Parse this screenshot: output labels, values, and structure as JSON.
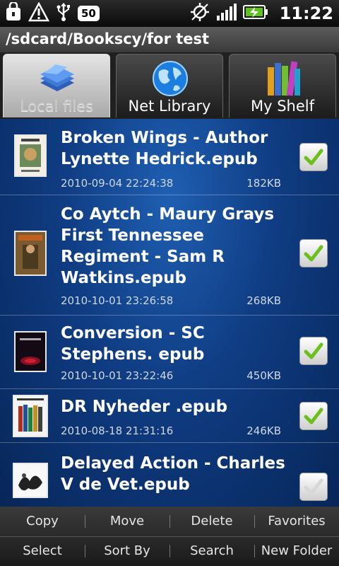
{
  "status_bar": {
    "icons_left": [
      "lock-bag-icon",
      "warning-icon",
      "usb-icon"
    ],
    "battery_text": "50",
    "icons_right": [
      "gps-icon",
      "signal-icon",
      "battery-charging-icon"
    ],
    "time": "11:22"
  },
  "path": "/sdcard/Bookscy/for test",
  "tabs": [
    {
      "label": "Local files",
      "icon": "local-files-icon",
      "active": true
    },
    {
      "label": "Net Library",
      "icon": "globe-icon",
      "active": false
    },
    {
      "label": "My Shelf",
      "icon": "books-icon",
      "active": false
    }
  ],
  "files": [
    {
      "name": "Broken Wings - Author Lynette Hedrick.epub",
      "date": "2010-09-04 22:24:38",
      "size": "182KB",
      "checked": true
    },
    {
      "name": "Co Aytch - Maury Grays First Tennessee Regiment - Sam R Watkins.epub",
      "date": "2010-10-01 23:26:58",
      "size": "268KB",
      "checked": true
    },
    {
      "name": "Conversion - SC Stephens. epub",
      "date": "2010-10-01 23:22:46",
      "size": "450KB",
      "checked": true
    },
    {
      "name": "DR Nyheder .epub",
      "date": "2010-08-18 21:31:16",
      "size": "246KB",
      "checked": true
    },
    {
      "name": "Delayed Action - Charles V de Vet.epub",
      "date": "",
      "size": "",
      "checked": false
    }
  ],
  "menu": {
    "row1": [
      "Copy",
      "Move",
      "Delete",
      "Favorites"
    ],
    "row2": [
      "Select",
      "Sort By",
      "Search",
      "New Folder"
    ]
  },
  "colors": {
    "list_background": "#0f3c82",
    "check_green": "#6cbf1c"
  }
}
